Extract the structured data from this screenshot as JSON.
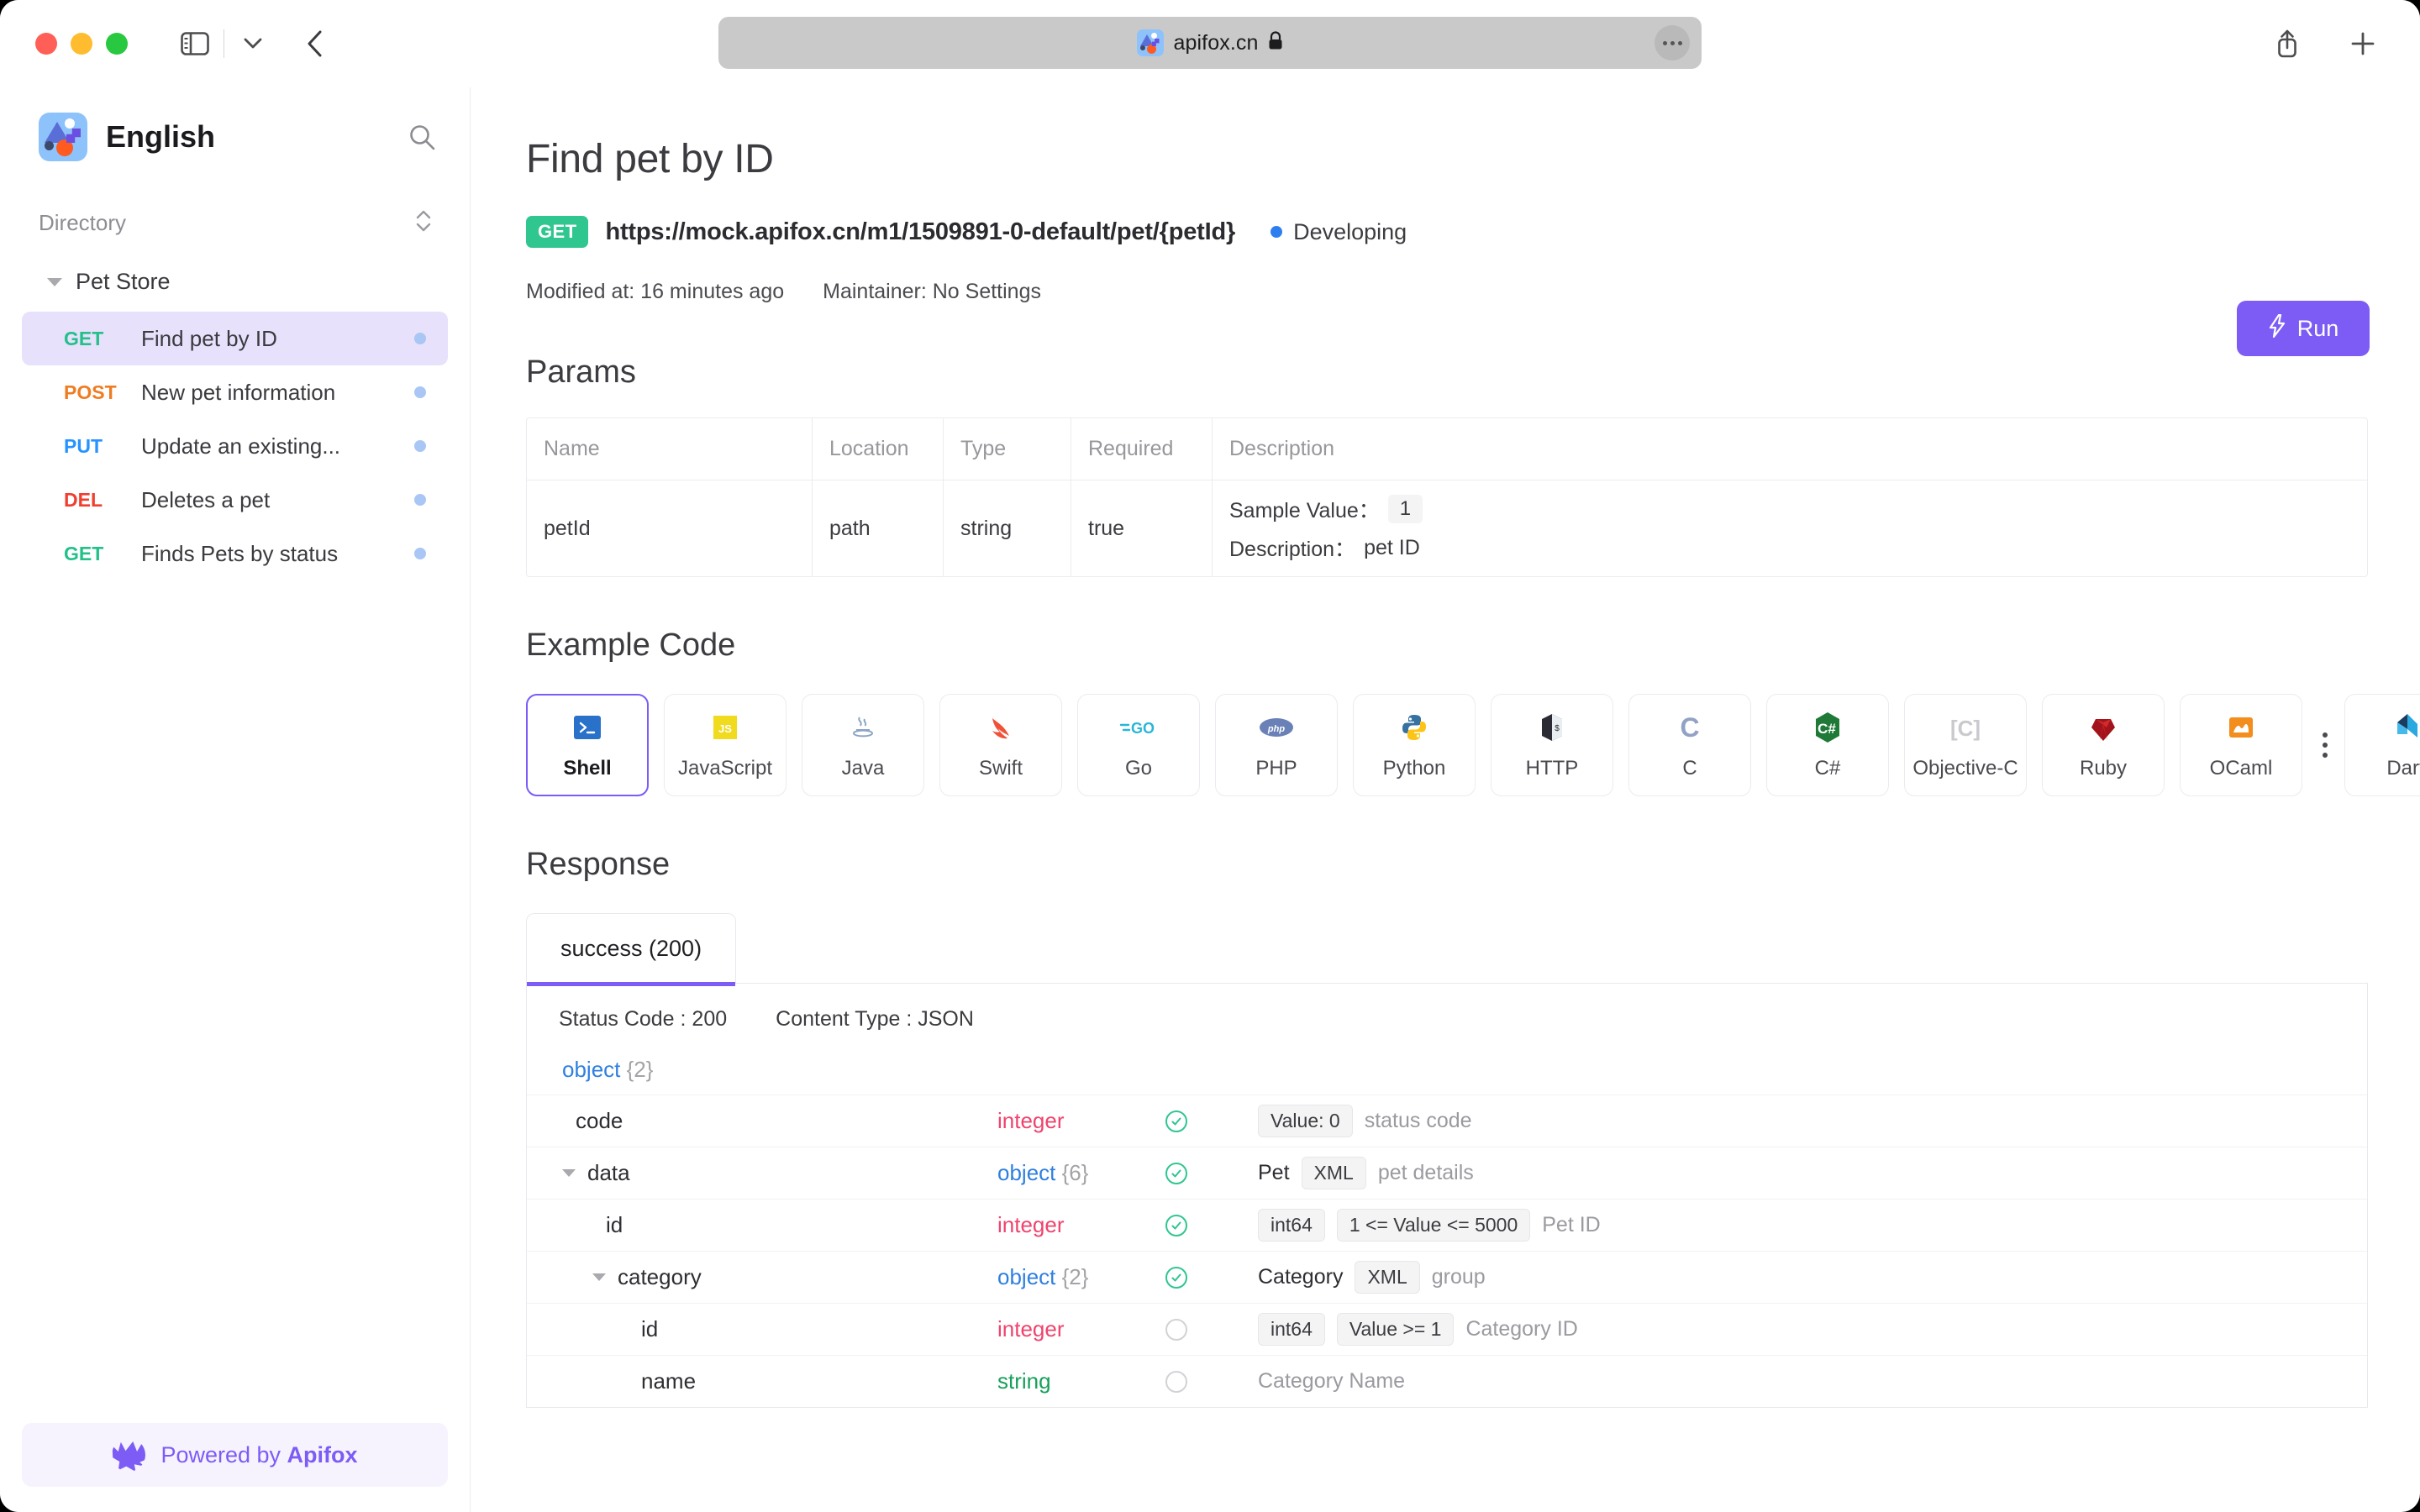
{
  "browser": {
    "url": "apifox.cn",
    "lock_icon": "lock-icon",
    "sidebar_toggle_icon": "sidebar-toggle-icon",
    "back_icon": "back-chevron-icon",
    "share_icon": "share-icon",
    "newtab_icon": "plus-icon"
  },
  "sidebar": {
    "title": "English",
    "search_icon": "search-icon",
    "directory_label": "Directory",
    "collapse_icon": "expand-collapse-icon",
    "group": {
      "label": "Pet Store",
      "expanded": true
    },
    "items": [
      {
        "method": "GET",
        "name": "Find pet by ID",
        "active": true
      },
      {
        "method": "POST",
        "name": "New pet information",
        "active": false
      },
      {
        "method": "PUT",
        "name": "Update an existing...",
        "active": false
      },
      {
        "method": "DEL",
        "name": "Deletes a pet",
        "active": false
      },
      {
        "method": "GET",
        "name": "Finds Pets by status",
        "active": false
      }
    ],
    "powered": {
      "prefix": "Powered by ",
      "brand": "Apifox",
      "icon": "apifox-fox-icon"
    }
  },
  "main": {
    "page_title": "Find pet by ID",
    "method_badge": "GET",
    "url": "https://mock.apifox.cn/m1/1509891-0-default/pet/{petId}",
    "status": "Developing",
    "run_label": "Run",
    "run_icon": "lightning-bolt-icon",
    "modified": "Modified at: 16 minutes ago",
    "maintainer": "Maintainer: No Settings",
    "params": {
      "section_title": "Params",
      "headers": [
        "Name",
        "Location",
        "Type",
        "Required",
        "Description"
      ],
      "rows": [
        {
          "name": "petId",
          "location": "path",
          "type": "string",
          "required": "true",
          "sample_label": "Sample Value：",
          "sample_value": "1",
          "desc_label": "Description：",
          "desc_value": "pet ID"
        }
      ]
    },
    "example_code": {
      "section_title": "Example Code",
      "selected": "Shell",
      "tabs": [
        {
          "label": "Shell",
          "icon": "shell-icon"
        },
        {
          "label": "JavaScript",
          "icon": "javascript-icon"
        },
        {
          "label": "Java",
          "icon": "java-icon"
        },
        {
          "label": "Swift",
          "icon": "swift-icon"
        },
        {
          "label": "Go",
          "icon": "go-icon"
        },
        {
          "label": "PHP",
          "icon": "php-icon"
        },
        {
          "label": "Python",
          "icon": "python-icon"
        },
        {
          "label": "HTTP",
          "icon": "http-icon"
        },
        {
          "label": "C",
          "icon": "c-icon"
        },
        {
          "label": "C#",
          "icon": "csharp-icon"
        },
        {
          "label": "Objective-C",
          "icon": "objective-c-icon"
        },
        {
          "label": "Ruby",
          "icon": "ruby-icon"
        },
        {
          "label": "OCaml",
          "icon": "ocaml-icon"
        },
        {
          "label": "Dart",
          "icon": "dart-icon"
        }
      ],
      "overflow_icon": "more-vertical-icon"
    },
    "response": {
      "section_title": "Response",
      "tabs": [
        {
          "label": "success (200)",
          "selected": true
        }
      ],
      "status_code": "Status Code : 200",
      "content_type": "Content Type : JSON",
      "root": {
        "type": "object",
        "count": "{2}"
      },
      "rows": [
        {
          "indent": 1,
          "expandable": false,
          "key": "code",
          "type": "integer",
          "count": "",
          "required": true,
          "ref": "",
          "badges": [
            "Value: 0"
          ],
          "desc": "status code"
        },
        {
          "indent": 1,
          "expandable": true,
          "key": "data",
          "type": "object",
          "count": "{6}",
          "required": true,
          "ref": "Pet",
          "badges": [
            "XML"
          ],
          "desc": "pet details"
        },
        {
          "indent": 2,
          "expandable": false,
          "key": "id",
          "type": "integer",
          "count": "",
          "required": true,
          "ref": "",
          "badges": [
            "int64",
            "1 <= Value <= 5000"
          ],
          "desc": "Pet ID"
        },
        {
          "indent": 2,
          "expandable": true,
          "key": "category",
          "type": "object",
          "count": "{2}",
          "required": true,
          "ref": "Category",
          "badges": [
            "XML"
          ],
          "desc": "group"
        },
        {
          "indent": 3,
          "expandable": false,
          "key": "id",
          "type": "integer",
          "count": "",
          "required": false,
          "ref": "",
          "badges": [
            "int64",
            "Value >= 1"
          ],
          "desc": "Category ID"
        },
        {
          "indent": 3,
          "expandable": false,
          "key": "name",
          "type": "string",
          "count": "",
          "required": false,
          "ref": "",
          "badges": [],
          "desc": "Category Name"
        }
      ]
    }
  },
  "colors": {
    "accent": "#7c5cf5",
    "get": "#24c08a",
    "post": "#f07c22",
    "put": "#2693ff",
    "del": "#f03e2f",
    "status": "#2d7ff0",
    "type_object": "#2f7fe0",
    "type_integer": "#f0436d",
    "type_string": "#18a05c"
  }
}
